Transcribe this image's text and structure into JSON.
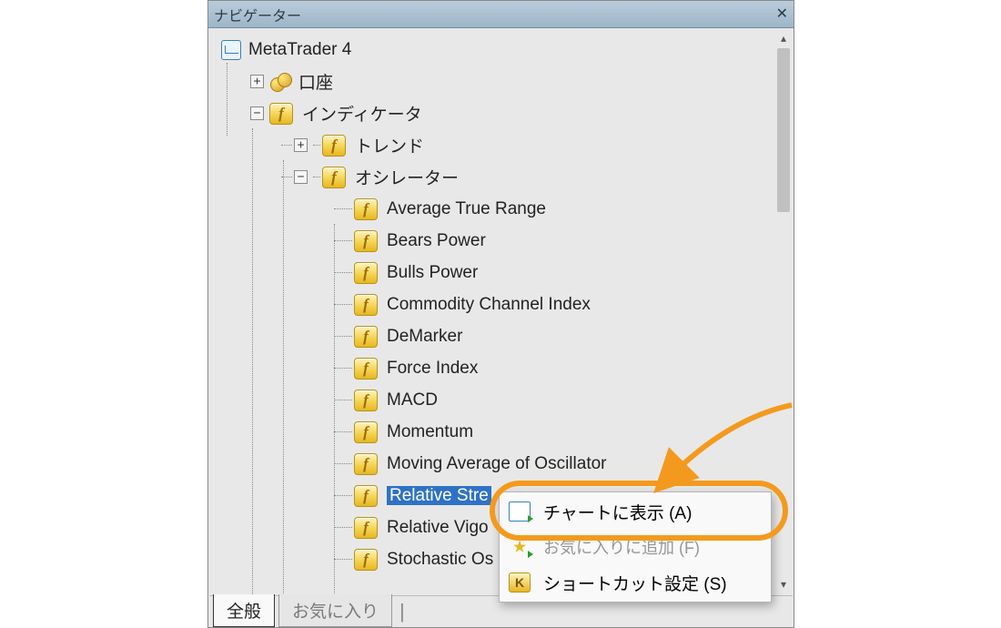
{
  "panel": {
    "title": "ナビゲーター"
  },
  "tree": {
    "root": "MetaTrader 4",
    "accounts": "口座",
    "indicators": "インディケータ",
    "trend": "トレンド",
    "oscillators": "オシレーター",
    "items": [
      "Average True Range",
      "Bears Power",
      "Bulls Power",
      "Commodity Channel Index",
      "DeMarker",
      "Force Index",
      "MACD",
      "Momentum",
      "Moving Average of Oscillator",
      "Relative Strength Index",
      "Relative Vigor Index",
      "Stochastic Oscillator"
    ],
    "selected_index": 9
  },
  "tabs": {
    "general": "全般",
    "favorites": "お気に入り"
  },
  "context_menu": {
    "show_on_chart": "チャートに表示 (A)",
    "add_favorite": "お気に入りに追加 (F)",
    "shortcut": "ショートカット設定 (S)"
  }
}
